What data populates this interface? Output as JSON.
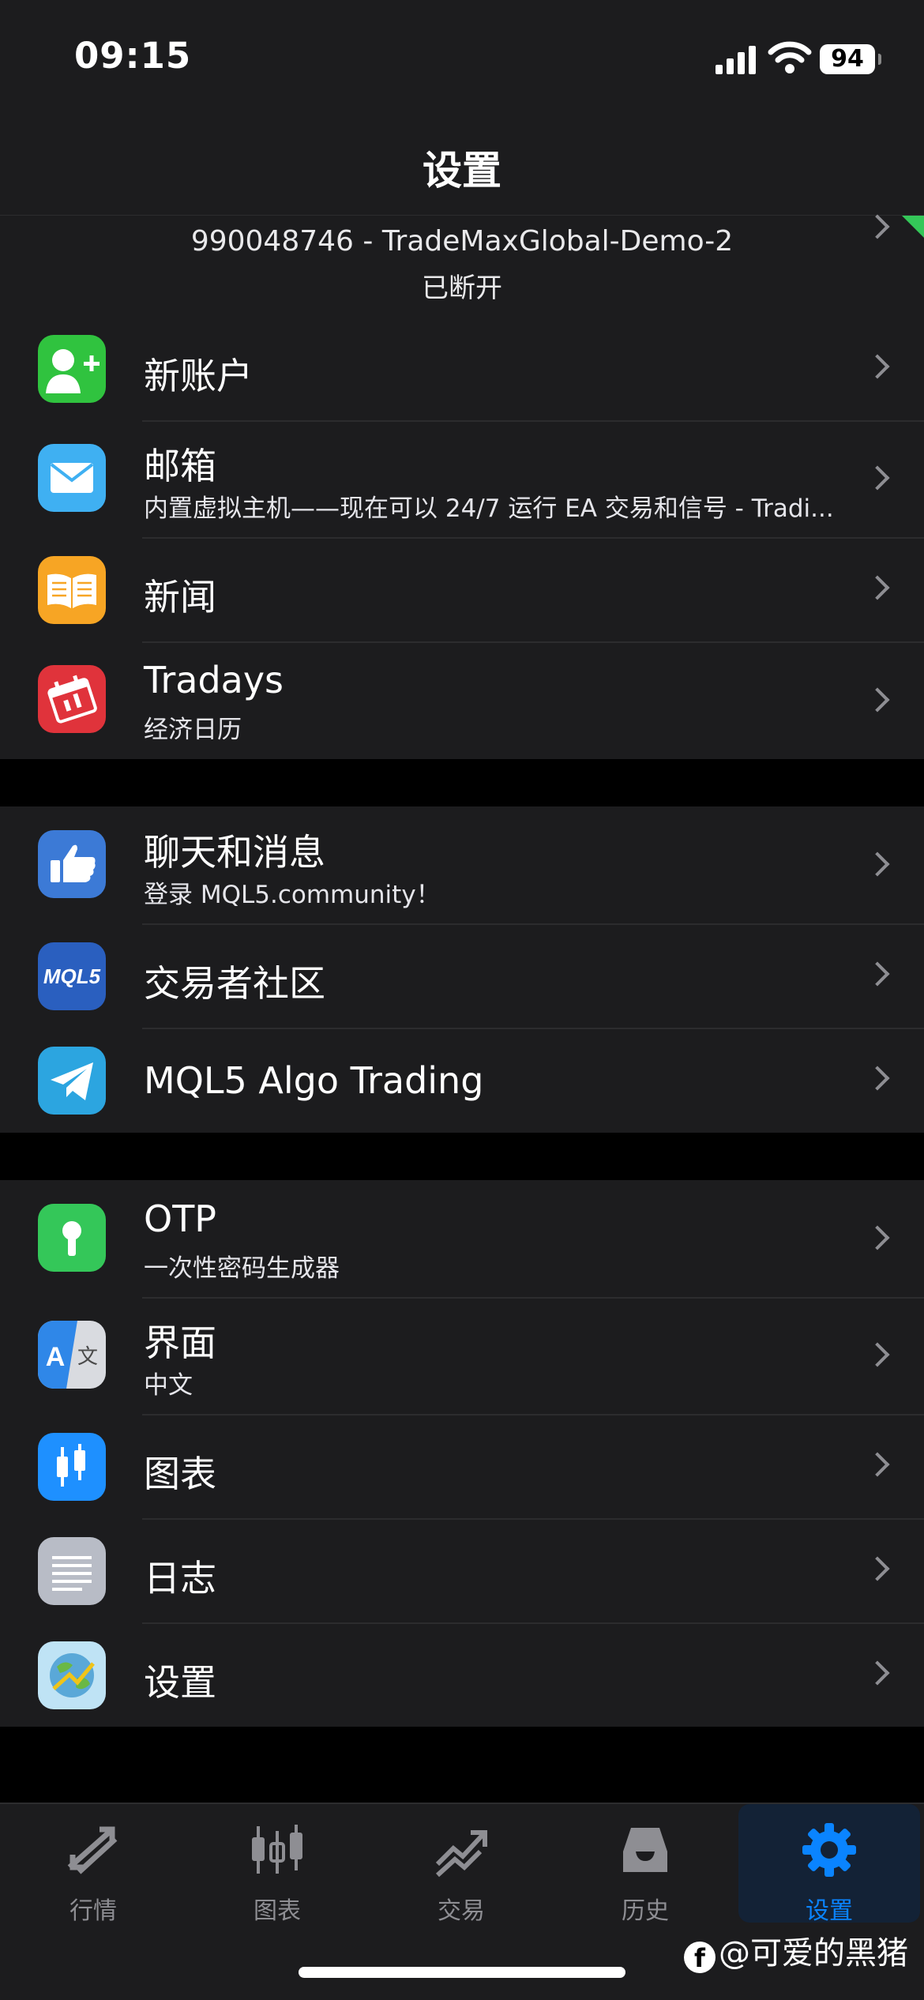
{
  "status": {
    "time": "09:15",
    "battery": "94"
  },
  "nav": {
    "title": "设置"
  },
  "account": {
    "server": "990048746 - TradeMaxGlobal-Demo-2",
    "state": "已断开"
  },
  "groups": [
    {
      "rows": [
        {
          "title": "新账户",
          "icon": "new-account-icon"
        },
        {
          "title": "邮箱",
          "subtitle": "内置虚拟主机——现在可以 24/7 运行 EA 交易和信号 - Tradi...",
          "icon": "mail-icon"
        },
        {
          "title": "新闻",
          "icon": "news-book-icon"
        },
        {
          "title": "Tradays",
          "subtitle": "经济日历",
          "icon": "calendar-icon"
        }
      ]
    },
    {
      "rows": [
        {
          "title": "聊天和消息",
          "subtitle": "登录 MQL5.community！",
          "icon": "chat-hand-icon"
        },
        {
          "title": "交易者社区",
          "icon": "mql5-logo-icon",
          "icon_text": "MQL5"
        },
        {
          "title": "MQL5 Algo Trading",
          "icon": "telegram-icon"
        }
      ]
    },
    {
      "rows": [
        {
          "title": "OTP",
          "subtitle": "一次性密码生成器",
          "icon": "otp-keyhole-icon"
        },
        {
          "title": "界面",
          "subtitle": "中文",
          "icon": "language-icon",
          "icon_text": [
            "A",
            "文"
          ]
        },
        {
          "title": "图表",
          "icon": "candlestick-icon"
        },
        {
          "title": "日志",
          "icon": "journal-icon"
        },
        {
          "title": "设置",
          "icon": "metatrader-icon"
        }
      ]
    }
  ],
  "tabs": [
    {
      "label": "行情",
      "icon": "quotes-icon"
    },
    {
      "label": "图表",
      "icon": "charts-icon"
    },
    {
      "label": "交易",
      "icon": "trade-icon"
    },
    {
      "label": "历史",
      "icon": "history-icon"
    },
    {
      "label": "设置",
      "icon": "settings-gear-icon",
      "active": true
    }
  ],
  "watermark": {
    "brand": "f",
    "text": "@可爱的黑猪"
  },
  "colors": {
    "background": "#000000",
    "cell": "#1c1c1e",
    "accent": "#0a84ff",
    "chevron": "#8e8e93"
  }
}
